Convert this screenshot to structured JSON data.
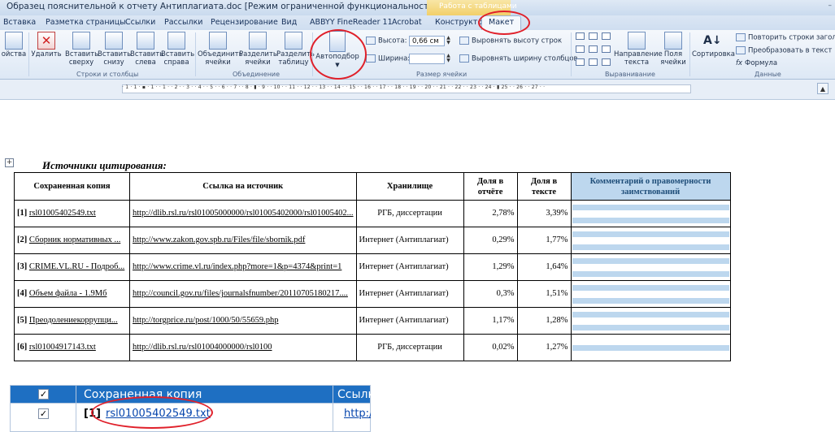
{
  "window": {
    "title": "Образец пояснительной к отчету Антиплагиата.doc [Режим ограниченной функциональности] - Microsoft Word",
    "context_title": "Работа с таблицами",
    "controls": "–"
  },
  "tabs": [
    "Вставка",
    "Разметка страницы",
    "Ссылки",
    "Рассылки",
    "Рецензирование",
    "Вид",
    "ABBYY FineReader 11",
    "Acrobat",
    "Конструктор",
    "Макет"
  ],
  "ribbon": {
    "props_label": "ойства",
    "delete_label": "Удалить",
    "insert_above": "Вставить сверху",
    "insert_below": "Вставить снизу",
    "insert_left": "Вставить слева",
    "insert_right": "Вставить справа",
    "group_rows_cols": "Строки и столбцы",
    "merge_cells": "Объединить ячейки",
    "split_cells": "Разделить ячейки",
    "split_table": "Разделить таблицу",
    "group_merge": "Объединение",
    "autofit": "Автоподбор",
    "height_label": "Высота:",
    "height_value": "0,66 см",
    "width_label": "Ширина:",
    "width_value": "",
    "distribute_rows": "Выровнять высоту строк",
    "distribute_cols": "Выровнять ширину столбцов",
    "group_cell_size": "Размер ячейки",
    "text_direction": "Направление текста",
    "cell_margins": "Поля ячейки",
    "group_alignment": "Выравнивание",
    "sort": "Сортировка",
    "repeat_header": "Повторить строки заголов",
    "convert_to_text": "Преобразовать в текст",
    "formula": "Формула",
    "group_data": "Данные"
  },
  "ruler": {
    "marks": "· 1 · 1 · ▪ · 1 · · 1 · · 2 · · 3 · · 4 · · 5 · · 6 · · 7 · · 8 · ▮ · 9 · · 10 · · 11 · · 12 · · 13 · · 14 · · 15 · · 16 · · 17 · · 18 · · 19 · · 20 · · 21 · · 22 · · 23 · · 24 · ▮ 25 · · 26 · · 27 · ·",
    "scroll_glyph": "▲"
  },
  "document": {
    "move_handle": "+",
    "title": "Источники цитирования:",
    "headers": [
      "Сохраненная копия",
      "Ссылка на источник",
      "Хранилище",
      "Доля в отчёте",
      "Доля в тексте",
      "Комментарий о правомерности заимствований"
    ],
    "rows": [
      {
        "num": "[1]",
        "copy": "rsl01005402549.txt",
        "link": "http://dlib.rsl.ru/rsl01005000000/rsl01005402000/rsl01005402...",
        "store": "РГБ, диссертации",
        "share_report": "2,78%",
        "share_text": "3,39%"
      },
      {
        "num": "[2]",
        "copy": "Сборник нормативных ...",
        "link": "http://www.zakon.gov.spb.ru/Files/file/sbornik.pdf",
        "store": "Интернет (Антиплагиат)",
        "share_report": "0,29%",
        "share_text": "1,77%"
      },
      {
        "num": "[3]",
        "copy": "CRIME.VL.RU - Подроб...",
        "link": "http://www.crime.vl.ru/index.php?more=1&p=4374&print=1",
        "store": "Интернет (Антиплагиат)",
        "share_report": "1,29%",
        "share_text": "1,64%"
      },
      {
        "num": "[4]",
        "copy": "Объем файла - 1.9Мб",
        "link": "http://council.gov.ru/files/journalsfnumber/20110705180217....",
        "store": "Интернет (Антиплагиат)",
        "share_report": "0,3%",
        "share_text": "1,51%"
      },
      {
        "num": "[5]",
        "copy": "Преодолениекоррупци...",
        "link": "http://torgprice.ru/post/1000/50/55659.php",
        "store": "Интернет (Антиплагиат)",
        "share_report": "1,17%",
        "share_text": "1,28%"
      },
      {
        "num": "[6]",
        "copy": "rsl01004917143.txt",
        "link": "http://dlib.rsl.ru/rsl01004000000/rsl0100",
        "store": "РГБ, диссертации",
        "share_report": "0,02%",
        "share_text": "1,27%"
      }
    ]
  },
  "snippet": {
    "check_glyph": "✓",
    "header_copy": "Сохраненная копия",
    "header_link": "Ссылк",
    "row_num": "[1]",
    "row_copy": "rsl01005402549.txt",
    "row_link": "http://"
  },
  "colors": {
    "annotation": "#e0202a",
    "comment_header": "#bdd7ee",
    "snippet_header": "#1e6fc2",
    "context_tab": "#f2cf69"
  }
}
